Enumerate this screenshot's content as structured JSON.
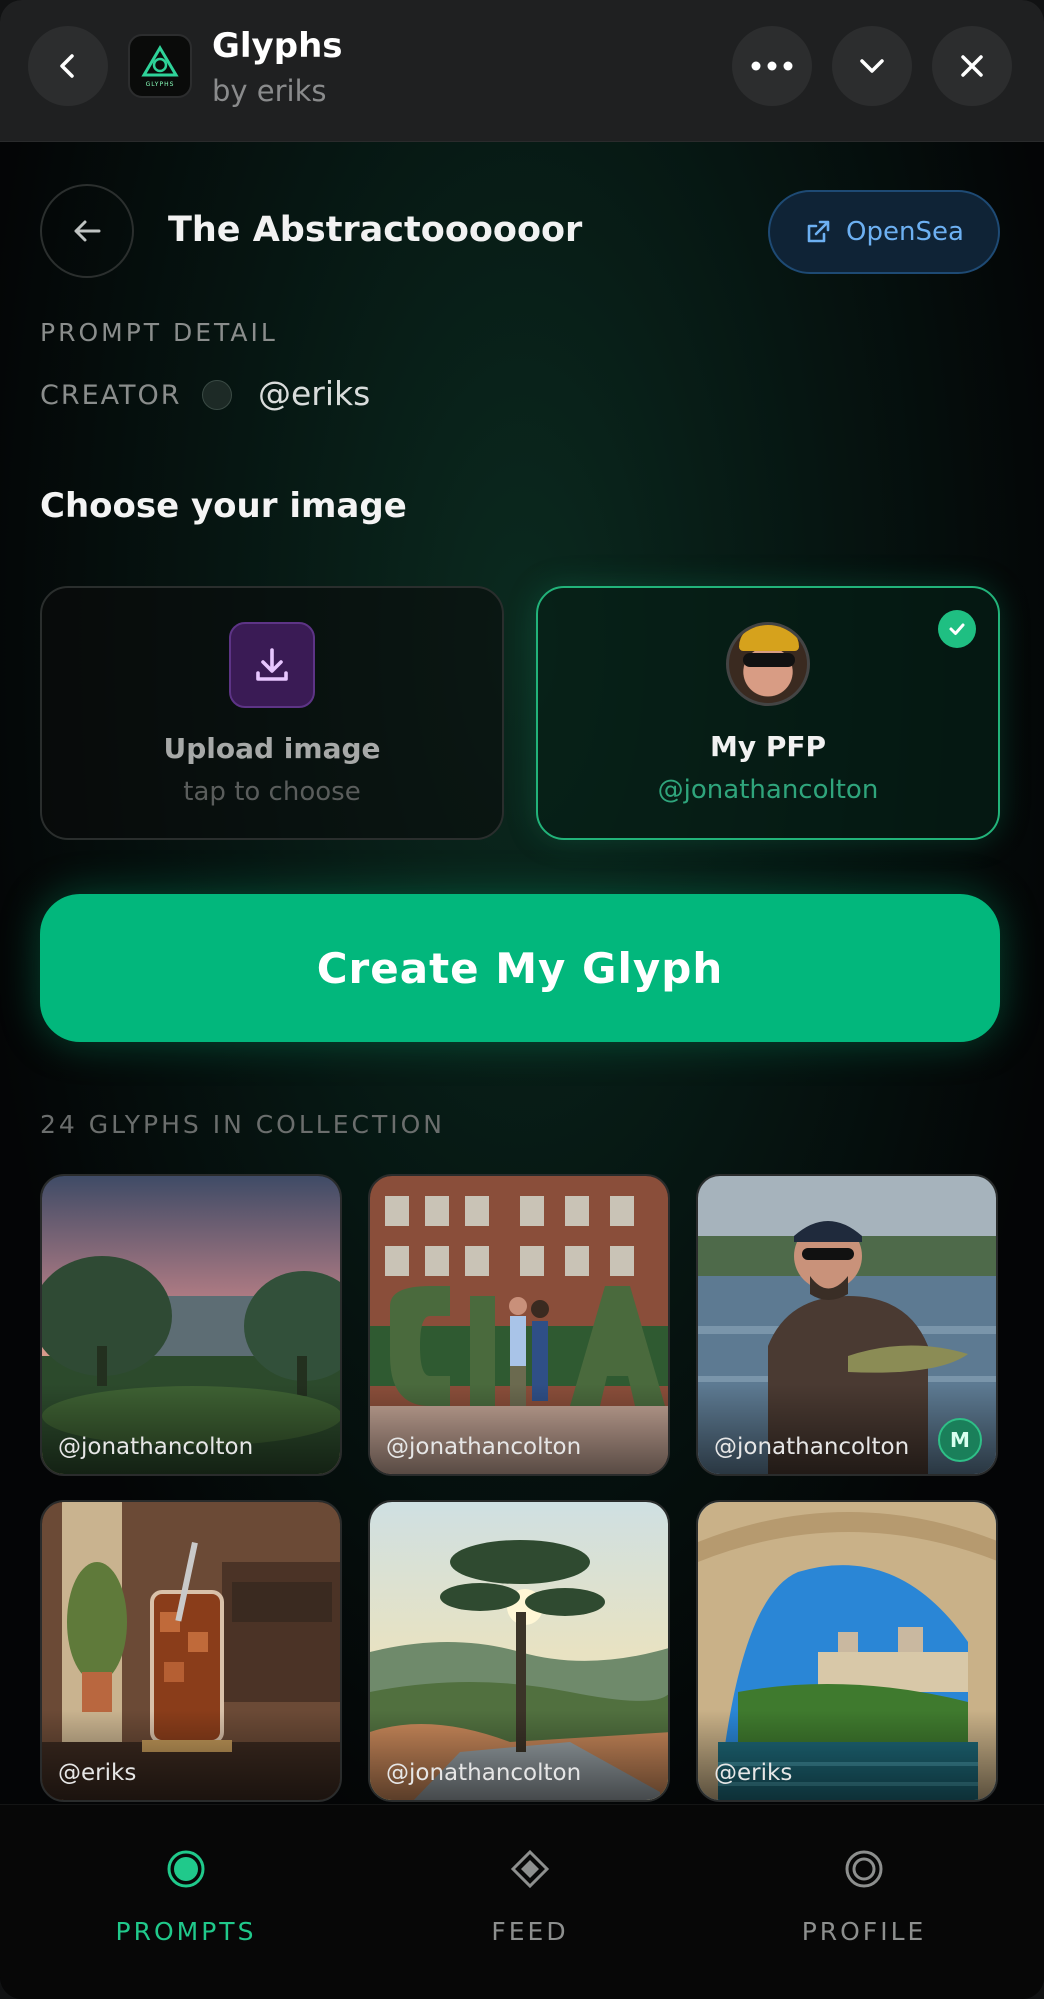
{
  "app": {
    "title": "Glyphs",
    "subtitle": "by eriks",
    "icon_text": "GLYPHS"
  },
  "prompt": {
    "title": "The Abstractoooooor",
    "opensea_label": "OpenSea",
    "section_label": "PROMPT DETAIL",
    "creator_label": "CREATOR",
    "creator_handle": "@eriks"
  },
  "chooser": {
    "title": "Choose your image",
    "upload": {
      "title": "Upload image",
      "subtitle": "tap to choose"
    },
    "pfp": {
      "title": "My PFP",
      "subtitle": "@jonathancolton",
      "selected": true
    }
  },
  "create_button": "Create My Glyph",
  "collection": {
    "label": "24 GLYPHS IN COLLECTION",
    "items": [
      {
        "handle": "@jonathancolton",
        "art": "sunset-park"
      },
      {
        "handle": "@jonathancolton",
        "art": "cia-letters-couple"
      },
      {
        "handle": "@jonathancolton",
        "art": "fisherman-boat",
        "badge": "M"
      },
      {
        "handle": "@eriks",
        "art": "iced-drink-cafe"
      },
      {
        "handle": "@jonathancolton",
        "art": "lone-tree-sunrise"
      },
      {
        "handle": "@eriks",
        "art": "stone-bridge-river"
      }
    ]
  },
  "tabs": [
    {
      "label": "PROMPTS",
      "icon": "radio-dot-icon",
      "active": true
    },
    {
      "label": "FEED",
      "icon": "diamond-icon",
      "active": false
    },
    {
      "label": "PROFILE",
      "icon": "ring-icon",
      "active": false
    }
  ],
  "colors": {
    "accent": "#02b77c",
    "opensea_blue": "#6db0f2",
    "upload_purple": "#3a1b55"
  }
}
